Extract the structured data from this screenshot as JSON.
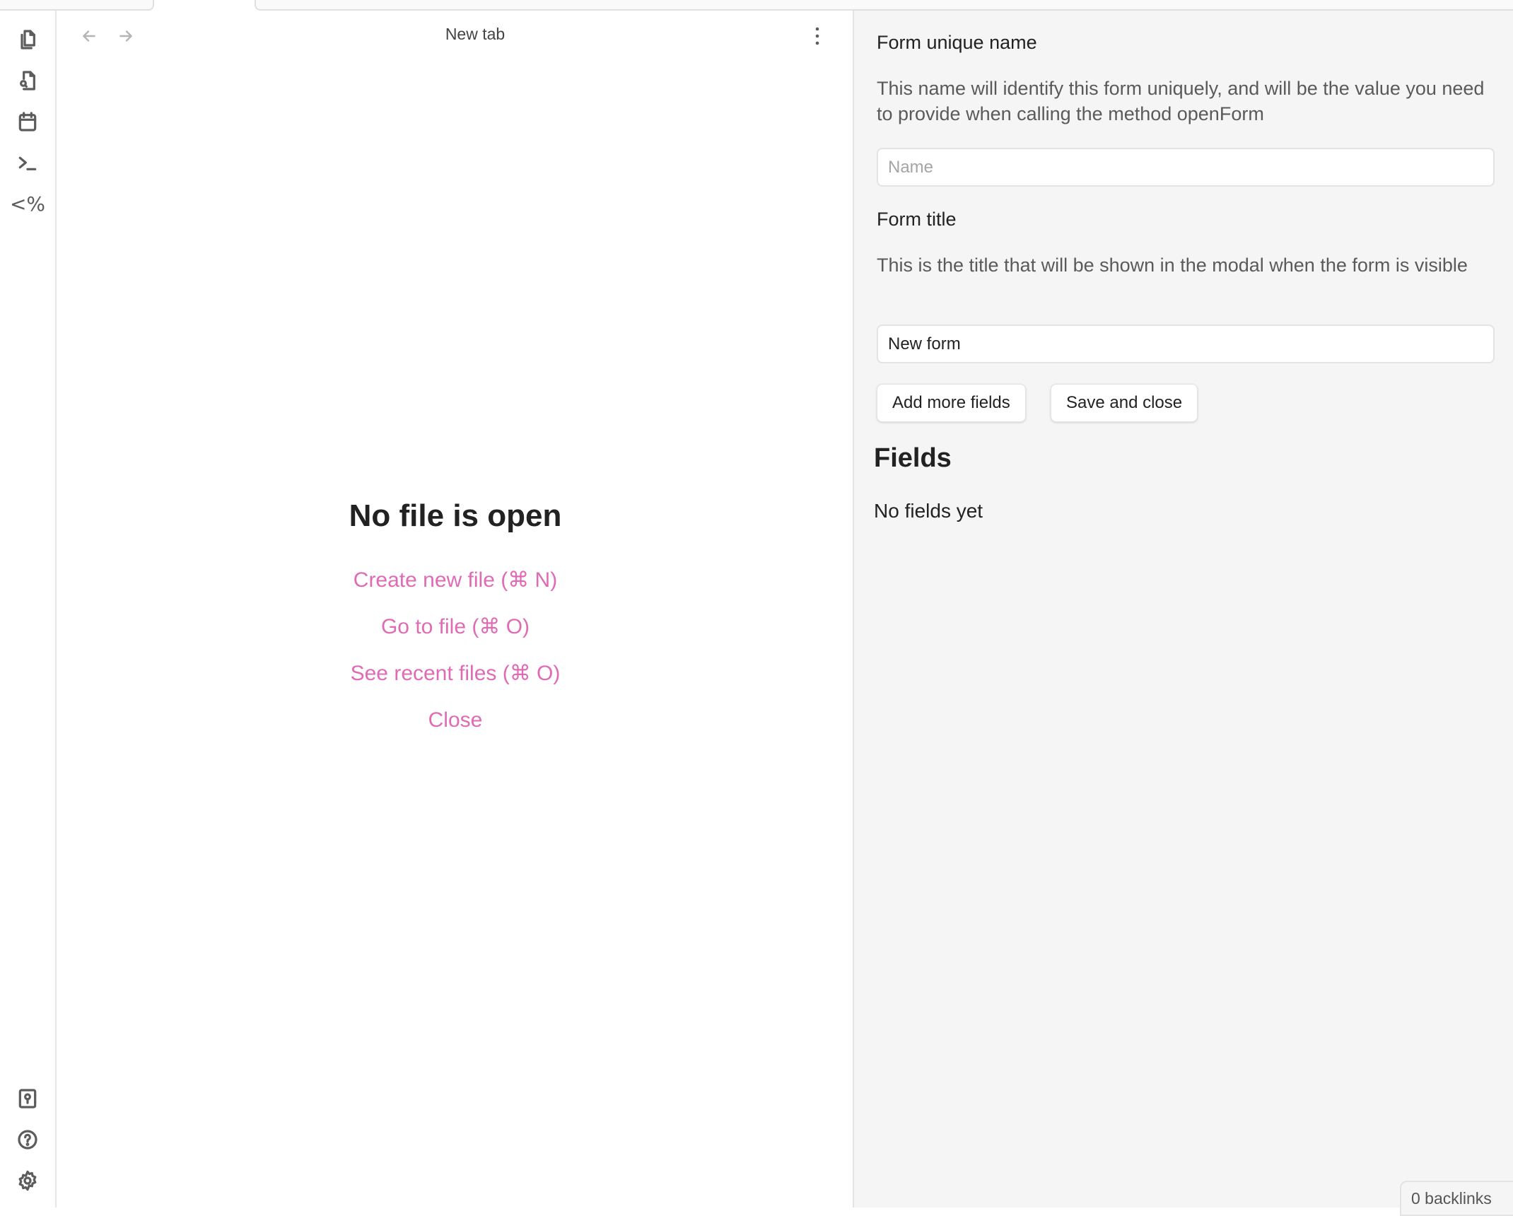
{
  "ribbon": {
    "top_icons": [
      {
        "name": "files-icon",
        "label": "Files"
      },
      {
        "name": "file-search-icon",
        "label": "Search"
      },
      {
        "name": "calendar-icon",
        "label": "Daily note"
      },
      {
        "name": "terminal-icon",
        "label": "Command palette"
      },
      {
        "name": "templater-icon",
        "label": "<%"
      }
    ],
    "bottom_icons": [
      {
        "name": "vault-icon",
        "label": "Open vault"
      },
      {
        "name": "help-icon",
        "label": "Help"
      },
      {
        "name": "settings-icon",
        "label": "Settings"
      }
    ]
  },
  "center": {
    "title": "New tab",
    "empty_state": {
      "heading": "No file is open",
      "actions": [
        "Create new file (⌘ N)",
        "Go to file (⌘ O)",
        "See recent files (⌘ O)",
        "Close"
      ]
    }
  },
  "form": {
    "name_label": "Form unique name",
    "name_desc": "This name will identify this form uniquely, and will be the value you need to provide when calling the method openForm",
    "name_placeholder": "Name",
    "name_value": "",
    "title_label": "Form title",
    "title_desc": "This is the title that will be shown in the modal when the form is visible",
    "title_value": "New form",
    "add_fields_label": "Add more fields",
    "save_close_label": "Save and close",
    "fields_heading": "Fields",
    "no_fields_text": "No fields yet"
  },
  "status_bar": {
    "backlinks": "0 backlinks"
  },
  "colors": {
    "accent_link": "#e06bb5",
    "panel_bg": "#f5f5f5"
  }
}
